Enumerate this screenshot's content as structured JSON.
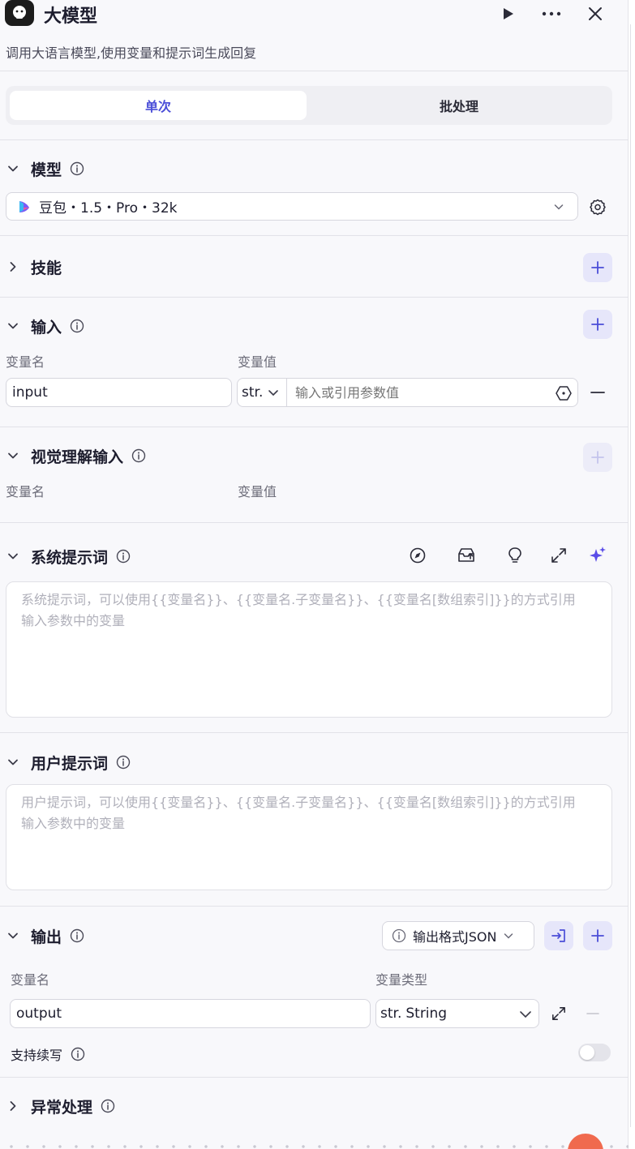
{
  "header": {
    "title": "大模型",
    "description": "调用大语言模型,使用变量和提示词生成回复"
  },
  "tabs": [
    {
      "label": "单次",
      "active": true
    },
    {
      "label": "批处理",
      "active": false
    }
  ],
  "model_section": {
    "title": "模型",
    "selected_model": "豆包・1.5・Pro・32k"
  },
  "skills_section": {
    "title": "技能"
  },
  "input_section": {
    "title": "输入",
    "col_name": "变量名",
    "col_value": "变量值",
    "row": {
      "name": "input",
      "type": "str.",
      "value_placeholder": "输入或引用参数值"
    }
  },
  "vision_section": {
    "title": "视觉理解输入",
    "col_name": "变量名",
    "col_value": "变量值"
  },
  "system_prompt": {
    "title": "系统提示词",
    "placeholder_line1": "系统提示词，可以使用{{变量名}}、{{变量名.子变量名}}、{{变量名[数组索引]}}的方式引用",
    "placeholder_line2": "输入参数中的变量"
  },
  "user_prompt": {
    "title": "用户提示词",
    "placeholder_line1": "用户提示词，可以使用{{变量名}}、{{变量名.子变量名}}、{{变量名[数组索引]}}的方式引用",
    "placeholder_line2": "输入参数中的变量"
  },
  "output_section": {
    "title": "输出",
    "format_label": "输出格式JSON",
    "col_name": "变量名",
    "col_type": "变量类型",
    "row": {
      "name": "output",
      "type_prefix": "str.",
      "type_label": "String"
    },
    "continue_label": "支持续写",
    "continue_enabled": false
  },
  "exception_section": {
    "title": "异常处理"
  },
  "colors": {
    "accent": "#4b4ed8",
    "accent_bg": "#e6e6fa",
    "text": "#1d1d2e",
    "muted": "#6d6d7a",
    "border": "#d6d6de"
  }
}
